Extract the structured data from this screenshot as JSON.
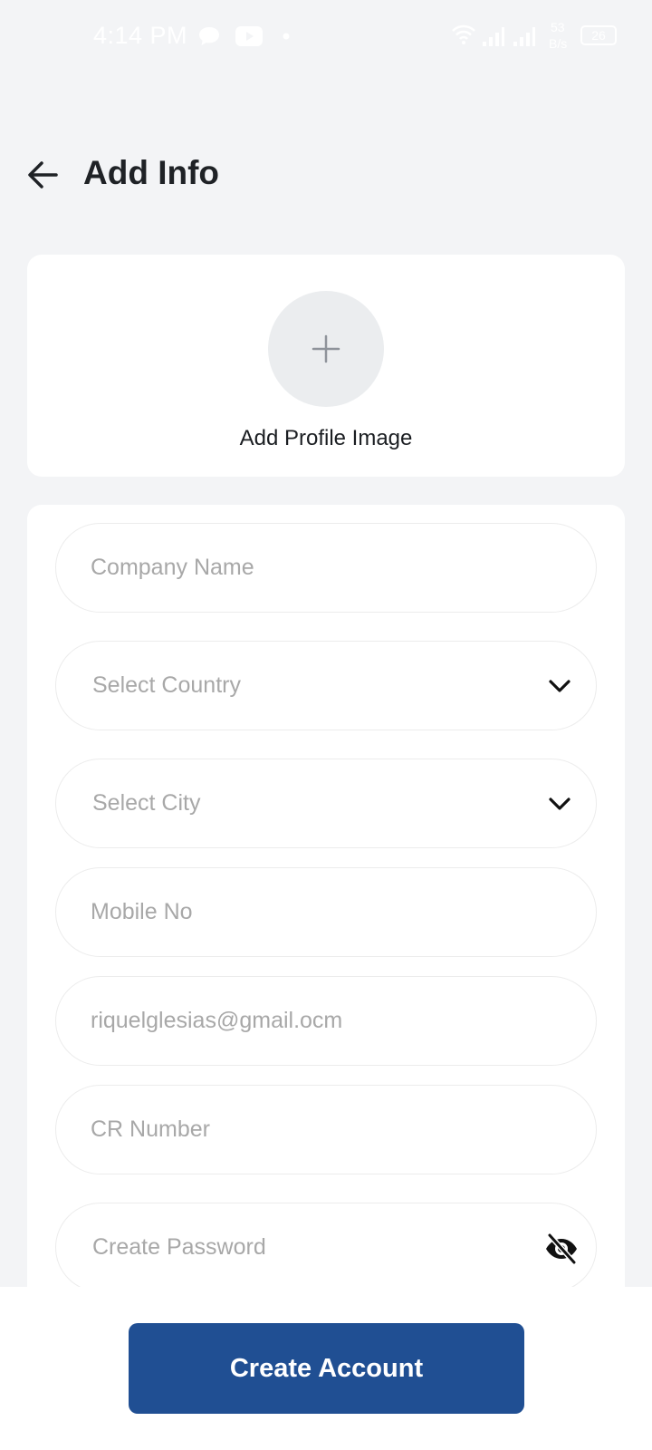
{
  "status_bar": {
    "time": "4:14 PM",
    "net_speed_value": "53",
    "net_speed_unit": "B/s",
    "battery": "26"
  },
  "header": {
    "title": "Add Info",
    "back_icon": "arrow-left-icon"
  },
  "profile": {
    "label": "Add Profile Image",
    "icon": "plus-icon"
  },
  "form": {
    "company_name": {
      "placeholder": "Company Name"
    },
    "country": {
      "placeholder": "Select Country"
    },
    "city": {
      "placeholder": "Select City"
    },
    "mobile": {
      "placeholder": "Mobile No"
    },
    "email": {
      "value": "riquelglesias@gmail.ocm"
    },
    "cr_number": {
      "placeholder": "CR Number"
    },
    "password": {
      "placeholder": "Create Password",
      "toggle_icon": "eye-off-icon"
    }
  },
  "actions": {
    "create_label": "Create Account"
  },
  "colors": {
    "primary": "#204f93",
    "background": "#f3f4f6",
    "placeholder": "#a8a8a8"
  }
}
